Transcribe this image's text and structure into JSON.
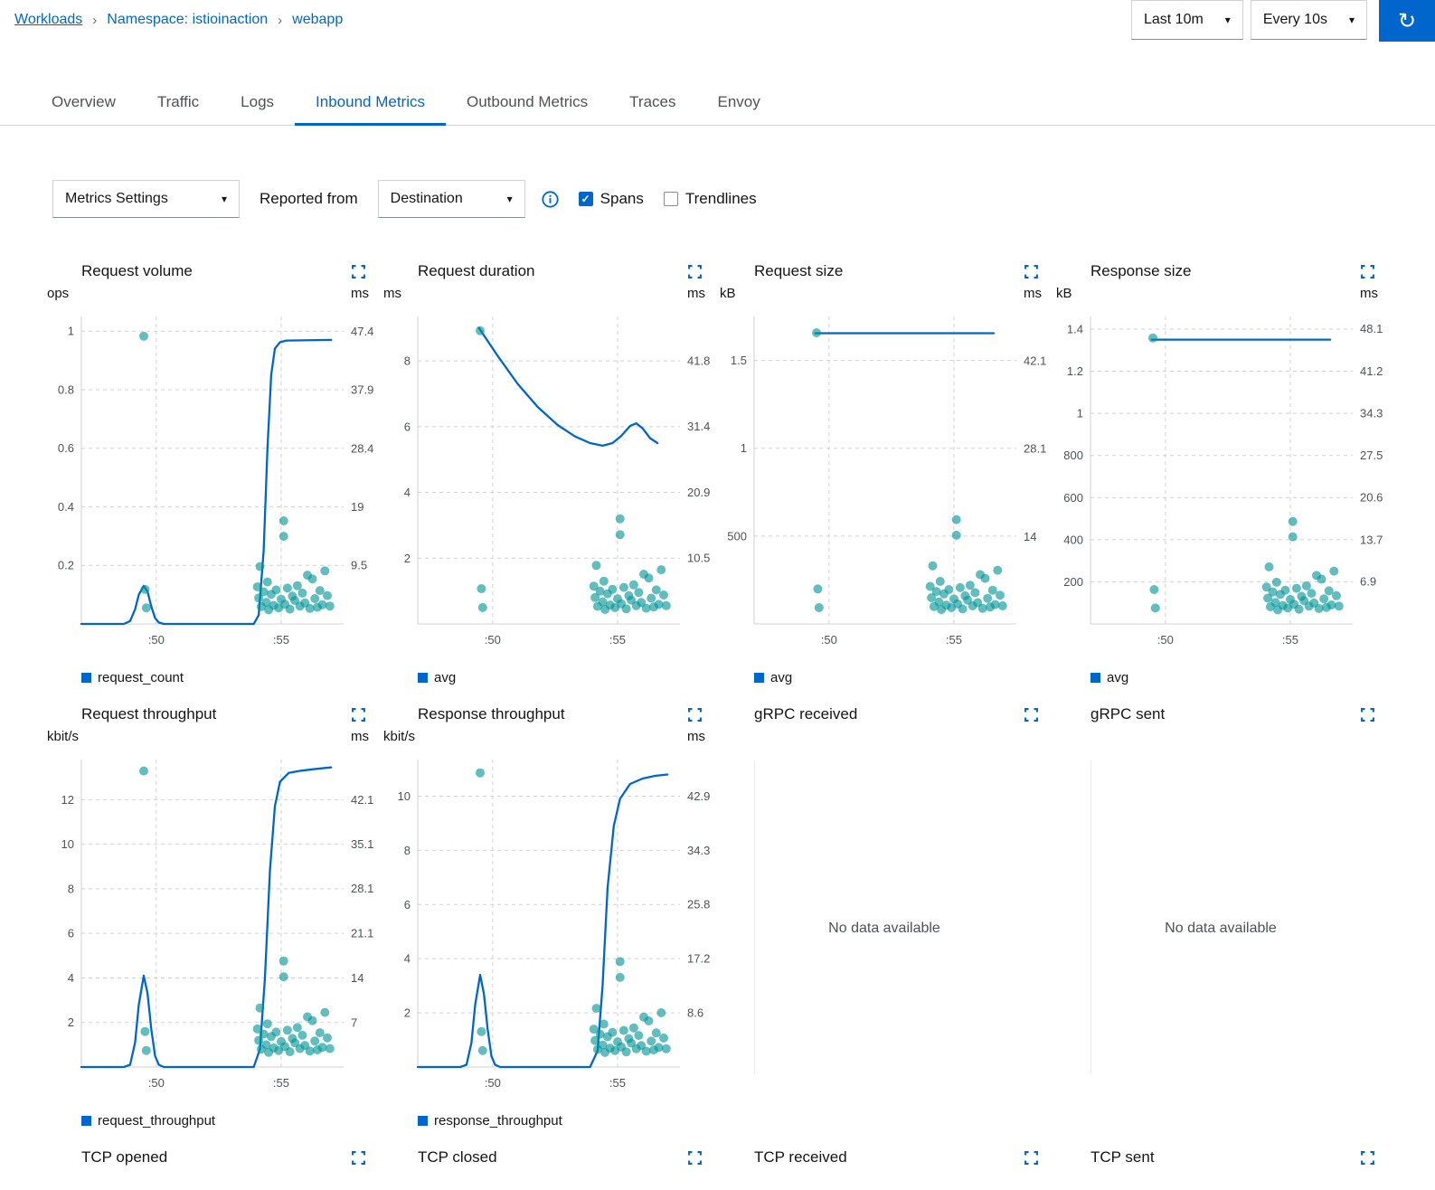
{
  "breadcrumb": {
    "items": [
      "Workloads",
      "Namespace: istioinaction",
      "webapp"
    ]
  },
  "toolbar": {
    "duration_label": "Last 10m",
    "refresh_label": "Every 10s"
  },
  "tabs": {
    "items": [
      "Overview",
      "Traffic",
      "Logs",
      "Inbound Metrics",
      "Outbound Metrics",
      "Traces",
      "Envoy"
    ],
    "active": "Inbound Metrics"
  },
  "controls": {
    "metrics_settings_label": "Metrics Settings",
    "reported_from_label": "Reported from",
    "reporter_value": "Destination",
    "spans_label": "Spans",
    "spans_checked": true,
    "trendlines_label": "Trendlines",
    "trendlines_checked": false
  },
  "colors": {
    "accent": "#0066cc",
    "line": "#0066cc",
    "spans": "#009596",
    "grid": "#d2d2d2",
    "tick_text": "#4f5255"
  },
  "no_data_text": "No data available",
  "chart_spans_ms": [
    [
      49.5,
      46.6
    ],
    [
      49.55,
      5.6
    ],
    [
      49.6,
      2.6
    ],
    [
      54.05,
      6.0
    ],
    [
      54.1,
      4.2
    ],
    [
      54.15,
      9.3
    ],
    [
      54.2,
      2.8
    ],
    [
      54.3,
      5.2
    ],
    [
      54.4,
      3.5
    ],
    [
      54.45,
      6.8
    ],
    [
      54.5,
      2.3
    ],
    [
      54.6,
      4.8
    ],
    [
      54.7,
      3.0
    ],
    [
      54.8,
      5.5
    ],
    [
      54.9,
      2.6
    ],
    [
      55.0,
      4.0
    ],
    [
      55.1,
      16.7
    ],
    [
      55.1,
      14.2
    ],
    [
      55.15,
      3.2
    ],
    [
      55.25,
      5.8
    ],
    [
      55.35,
      2.4
    ],
    [
      55.45,
      4.5
    ],
    [
      55.55,
      3.8
    ],
    [
      55.65,
      6.2
    ],
    [
      55.75,
      2.9
    ],
    [
      55.85,
      5.0
    ],
    [
      55.95,
      3.4
    ],
    [
      56.05,
      7.9
    ],
    [
      56.15,
      2.5
    ],
    [
      56.25,
      7.3
    ],
    [
      56.35,
      4.1
    ],
    [
      56.45,
      2.7
    ],
    [
      56.55,
      5.4
    ],
    [
      56.65,
      3.1
    ],
    [
      56.75,
      8.6
    ],
    [
      56.85,
      4.6
    ],
    [
      56.95,
      2.9
    ]
  ],
  "chart_data": [
    {
      "type": "line+scatter",
      "title": "Request volume",
      "unit_left": "ops",
      "unit_right": "ms",
      "x": {
        "min": 47.0,
        "max": 57.5,
        "ticks": [
          [
            50,
            ":50"
          ],
          [
            55,
            ":55"
          ]
        ]
      },
      "left": {
        "max": 1.05,
        "ticks": [
          [
            1,
            "1"
          ],
          [
            0.8,
            "0.8"
          ],
          [
            0.6,
            "0.6"
          ],
          [
            0.4,
            "0.4"
          ],
          [
            0.2,
            "0.2"
          ]
        ]
      },
      "right": {
        "max": 49.8,
        "ticks": [
          [
            47.4,
            "47.4"
          ],
          [
            37.9,
            "37.9"
          ],
          [
            28.4,
            "28.4"
          ],
          [
            19,
            "19"
          ],
          [
            9.5,
            "9.5"
          ]
        ]
      },
      "series": {
        "name": "request_count",
        "points": [
          [
            47.0,
            0
          ],
          [
            48.7,
            0
          ],
          [
            48.95,
            0.01
          ],
          [
            49.15,
            0.05
          ],
          [
            49.3,
            0.1
          ],
          [
            49.5,
            0.13
          ],
          [
            49.65,
            0.11
          ],
          [
            49.8,
            0.06
          ],
          [
            49.95,
            0.02
          ],
          [
            50.1,
            0.005
          ],
          [
            50.3,
            0
          ],
          [
            53.9,
            0
          ],
          [
            54.1,
            0.03
          ],
          [
            54.3,
            0.25
          ],
          [
            54.45,
            0.6
          ],
          [
            54.6,
            0.85
          ],
          [
            54.75,
            0.94
          ],
          [
            54.95,
            0.962
          ],
          [
            55.2,
            0.968
          ],
          [
            57.0,
            0.97
          ]
        ]
      },
      "spans": "@shared",
      "legend": "request_count"
    },
    {
      "type": "line+scatter",
      "title": "Request duration",
      "unit_left": "ms",
      "unit_right": "ms",
      "x": {
        "min": 47.0,
        "max": 57.5,
        "ticks": [
          [
            50,
            ":50"
          ],
          [
            55,
            ":55"
          ]
        ]
      },
      "left": {
        "max": 9.35,
        "ticks": [
          [
            8,
            "8"
          ],
          [
            6,
            "6"
          ],
          [
            4,
            "4"
          ],
          [
            2,
            "2"
          ]
        ]
      },
      "right": {
        "max": 48.85,
        "ticks": [
          [
            41.8,
            "41.8"
          ],
          [
            31.4,
            "31.4"
          ],
          [
            20.9,
            "20.9"
          ],
          [
            10.5,
            "10.5"
          ]
        ]
      },
      "series": {
        "name": "avg",
        "points": [
          [
            49.45,
            9.0
          ],
          [
            50.2,
            8.15
          ],
          [
            51.0,
            7.3
          ],
          [
            51.8,
            6.6
          ],
          [
            52.6,
            6.05
          ],
          [
            53.3,
            5.7
          ],
          [
            53.9,
            5.5
          ],
          [
            54.4,
            5.42
          ],
          [
            54.8,
            5.5
          ],
          [
            55.15,
            5.72
          ],
          [
            55.5,
            6.02
          ],
          [
            55.75,
            6.1
          ],
          [
            56.0,
            5.95
          ],
          [
            56.3,
            5.65
          ],
          [
            56.6,
            5.5
          ]
        ]
      },
      "spans": "@shared",
      "legend": "avg"
    },
    {
      "type": "line+scatter",
      "title": "Request size",
      "unit_left": "kB",
      "unit_right": "ms",
      "x": {
        "min": 47.0,
        "max": 57.5,
        "ticks": [
          [
            50,
            ":50"
          ],
          [
            55,
            ":55"
          ]
        ]
      },
      "left": {
        "max": 1750,
        "ticks": [
          [
            1500,
            "1.5"
          ],
          [
            1000,
            "1"
          ],
          [
            500,
            "500"
          ]
        ]
      },
      "right": {
        "max": 49.2,
        "ticks": [
          [
            42.1,
            "42.1"
          ],
          [
            28.1,
            "28.1"
          ],
          [
            14,
            "14"
          ]
        ]
      },
      "series": {
        "name": "avg",
        "points": [
          [
            49.45,
            1655
          ],
          [
            56.6,
            1655
          ]
        ]
      },
      "spans": "@shared",
      "legend": "avg"
    },
    {
      "type": "line+scatter",
      "title": "Response size",
      "unit_left": "kB",
      "unit_right": "ms",
      "x": {
        "min": 47.0,
        "max": 57.5,
        "ticks": [
          [
            50,
            ":50"
          ],
          [
            55,
            ":55"
          ]
        ]
      },
      "left": {
        "max": 1460,
        "ticks": [
          [
            1400,
            "1.4"
          ],
          [
            1200,
            "1.2"
          ],
          [
            1000,
            "1"
          ],
          [
            800,
            "800"
          ],
          [
            600,
            "600"
          ],
          [
            400,
            "400"
          ],
          [
            200,
            "200"
          ]
        ]
      },
      "right": {
        "max": 50.1,
        "ticks": [
          [
            48.1,
            "48.1"
          ],
          [
            41.2,
            "41.2"
          ],
          [
            34.3,
            "34.3"
          ],
          [
            27.5,
            "27.5"
          ],
          [
            20.6,
            "20.6"
          ],
          [
            13.7,
            "13.7"
          ],
          [
            6.9,
            "6.9"
          ]
        ]
      },
      "series": {
        "name": "avg",
        "points": [
          [
            49.45,
            1350
          ],
          [
            56.6,
            1350
          ]
        ]
      },
      "spans": "@shared",
      "legend": "avg"
    },
    {
      "type": "line+scatter",
      "title": "Request throughput",
      "unit_left": "kbit/s",
      "unit_right": "ms",
      "x": {
        "min": 47.0,
        "max": 57.5,
        "ticks": [
          [
            50,
            ":50"
          ],
          [
            55,
            ":55"
          ]
        ]
      },
      "left": {
        "max": 13.8,
        "ticks": [
          [
            12,
            "12"
          ],
          [
            10,
            "10"
          ],
          [
            8,
            "8"
          ],
          [
            6,
            "6"
          ],
          [
            4,
            "4"
          ],
          [
            2,
            "2"
          ]
        ]
      },
      "right": {
        "max": 48.4,
        "ticks": [
          [
            42.1,
            "42.1"
          ],
          [
            35.1,
            "35.1"
          ],
          [
            28.1,
            "28.1"
          ],
          [
            21.1,
            "21.1"
          ],
          [
            14,
            "14"
          ],
          [
            7,
            "7"
          ]
        ]
      },
      "series": {
        "name": "request_throughput",
        "points": [
          [
            47.0,
            0
          ],
          [
            48.7,
            0
          ],
          [
            48.95,
            0.1
          ],
          [
            49.15,
            1.1
          ],
          [
            49.3,
            2.8
          ],
          [
            49.5,
            4.1
          ],
          [
            49.65,
            3.3
          ],
          [
            49.8,
            1.7
          ],
          [
            49.95,
            0.5
          ],
          [
            50.1,
            0.1
          ],
          [
            50.3,
            0
          ],
          [
            53.9,
            0
          ],
          [
            54.15,
            0.8
          ],
          [
            54.35,
            4.0
          ],
          [
            54.55,
            8.8
          ],
          [
            54.75,
            11.7
          ],
          [
            54.95,
            12.8
          ],
          [
            55.3,
            13.2
          ],
          [
            55.8,
            13.3
          ],
          [
            56.4,
            13.38
          ],
          [
            57.0,
            13.45
          ]
        ]
      },
      "spans": "@shared",
      "legend": "request_throughput"
    },
    {
      "type": "line+scatter",
      "title": "Response throughput",
      "unit_left": "kbit/s",
      "unit_right": "ms",
      "x": {
        "min": 47.0,
        "max": 57.5,
        "ticks": [
          [
            50,
            ":50"
          ],
          [
            55,
            ":55"
          ]
        ]
      },
      "left": {
        "max": 11.35,
        "ticks": [
          [
            10,
            "10"
          ],
          [
            8,
            "8"
          ],
          [
            6,
            "6"
          ],
          [
            4,
            "4"
          ],
          [
            2,
            "2"
          ]
        ]
      },
      "right": {
        "max": 48.7,
        "ticks": [
          [
            42.9,
            "42.9"
          ],
          [
            34.3,
            "34.3"
          ],
          [
            25.8,
            "25.8"
          ],
          [
            17.2,
            "17.2"
          ],
          [
            8.6,
            "8.6"
          ]
        ]
      },
      "series": {
        "name": "response_throughput",
        "points": [
          [
            47.0,
            0
          ],
          [
            48.7,
            0
          ],
          [
            48.95,
            0.08
          ],
          [
            49.15,
            0.9
          ],
          [
            49.3,
            2.3
          ],
          [
            49.5,
            3.4
          ],
          [
            49.65,
            2.7
          ],
          [
            49.8,
            1.4
          ],
          [
            49.95,
            0.4
          ],
          [
            50.1,
            0.08
          ],
          [
            50.3,
            0
          ],
          [
            53.9,
            0
          ],
          [
            54.2,
            0.6
          ],
          [
            54.4,
            3.0
          ],
          [
            54.6,
            6.6
          ],
          [
            54.85,
            8.9
          ],
          [
            55.1,
            9.9
          ],
          [
            55.5,
            10.45
          ],
          [
            56.0,
            10.65
          ],
          [
            56.5,
            10.75
          ],
          [
            57.0,
            10.8
          ]
        ]
      },
      "spans": "@shared",
      "legend": "response_throughput"
    },
    {
      "type": "no_data",
      "title": "gRPC received"
    },
    {
      "type": "no_data",
      "title": "gRPC sent"
    },
    {
      "type": "stub",
      "title": "TCP opened"
    },
    {
      "type": "stub",
      "title": "TCP closed"
    },
    {
      "type": "stub",
      "title": "TCP received"
    },
    {
      "type": "stub",
      "title": "TCP sent"
    }
  ]
}
